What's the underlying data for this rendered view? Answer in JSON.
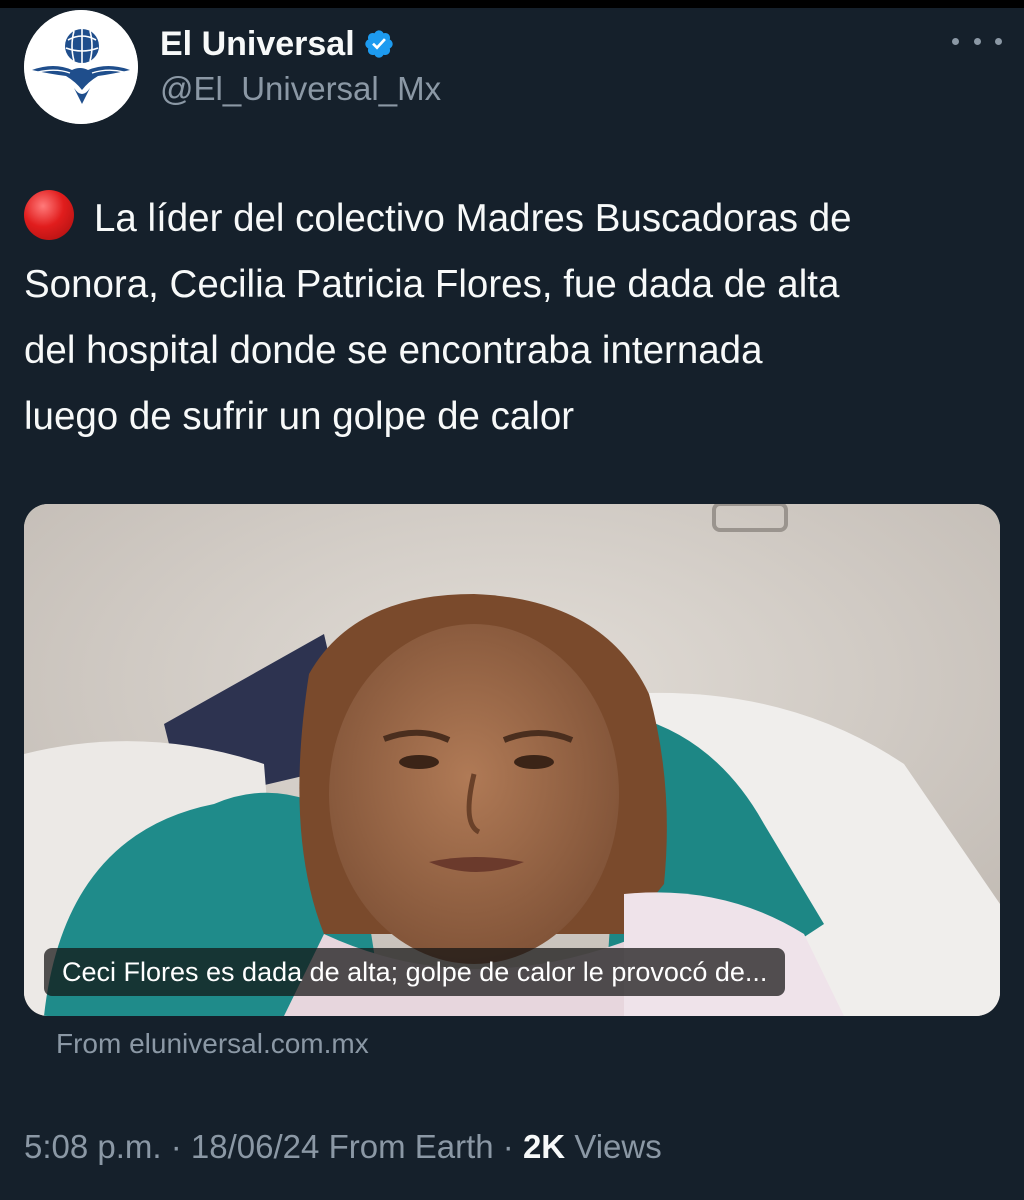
{
  "account": {
    "display_name": "El Universal",
    "handle": "@El_Universal_Mx",
    "verified": true,
    "avatar_icon": "eagle-globe-logo-icon"
  },
  "menu": {
    "icon": "more-options-icon"
  },
  "tweet": {
    "emoji": "red-circle-emoji",
    "lines": [
      "La líder del colectivo Madres Buscadoras de",
      "Sonora, Cecilia Patricia Flores, fue dada de alta",
      "del hospital donde se encontraba internada",
      "luego de sufrir un golpe de calor"
    ]
  },
  "link_card": {
    "caption": "Ceci Flores es dada de alta; golpe de calor le provocó de...",
    "source": "From eluniversal.com.mx"
  },
  "meta": {
    "time": "5:08 p.m.",
    "separator": "·",
    "date": "18/06/24",
    "location": "From Earth",
    "views_count": "2K",
    "views_label": "Views"
  },
  "colors": {
    "background": "#15202b",
    "text_primary": "#f7f9f9",
    "text_secondary": "#8b98a5",
    "verified_blue": "#1d9bf0"
  }
}
